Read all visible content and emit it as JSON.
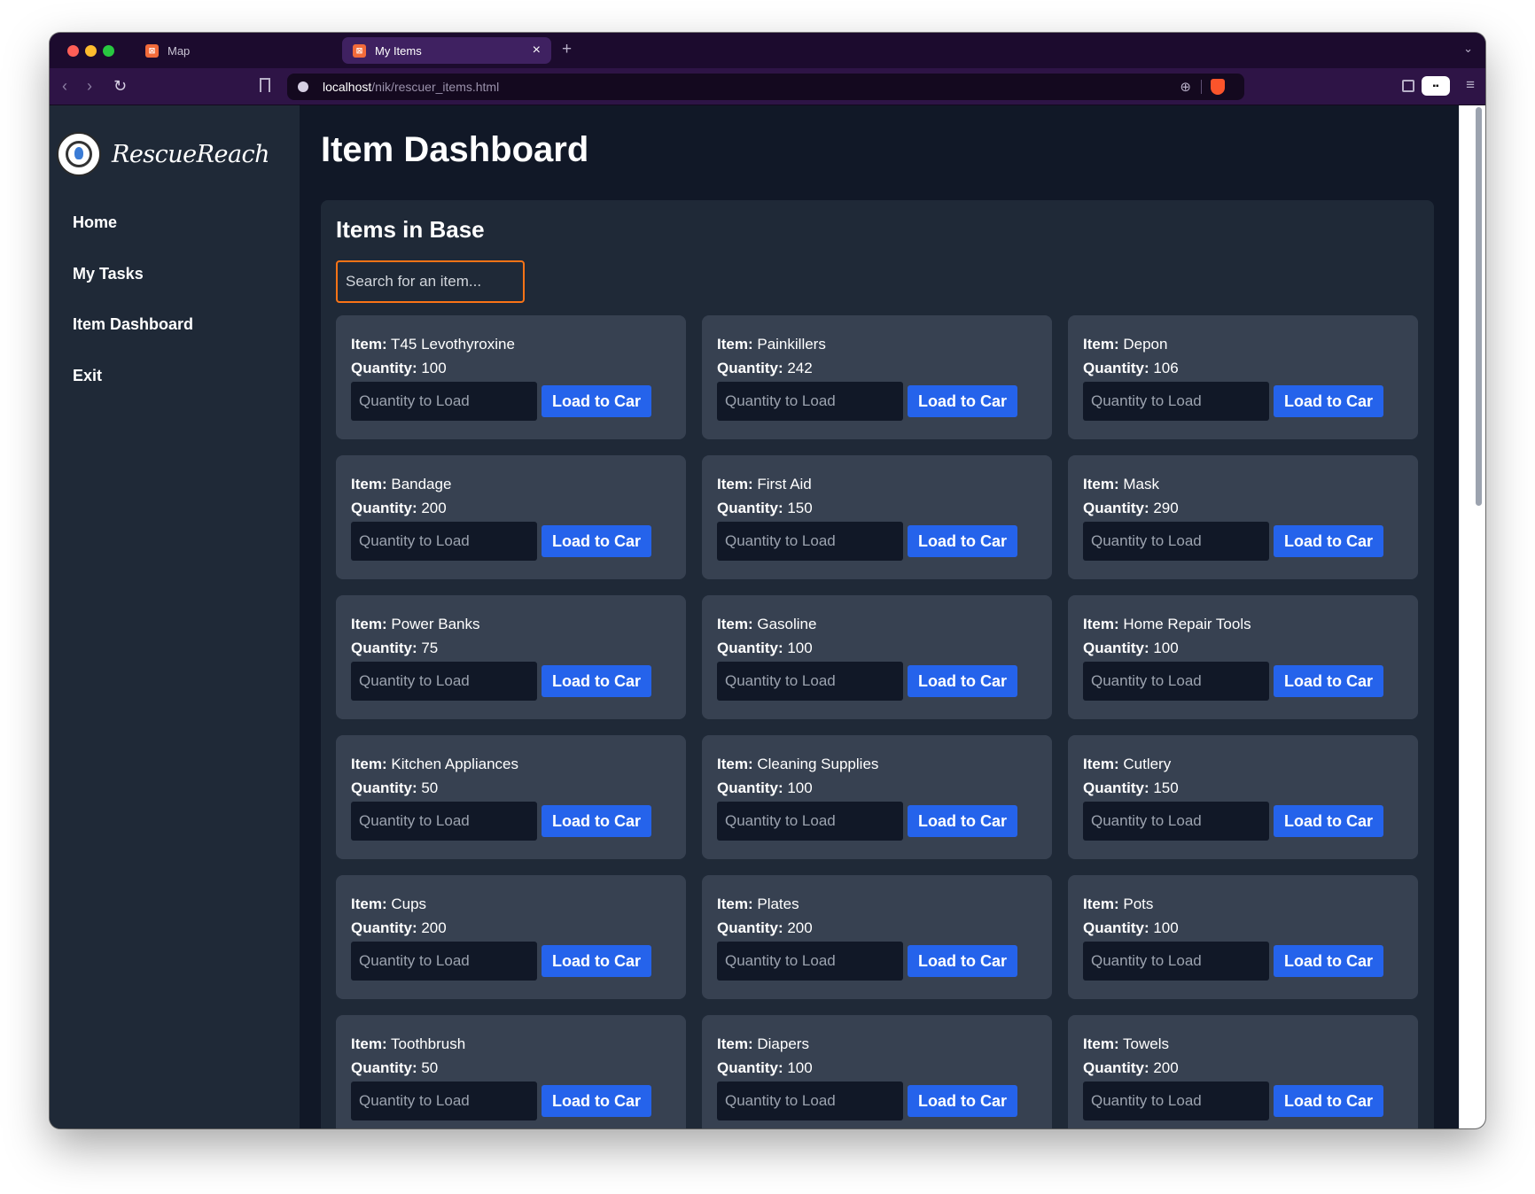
{
  "browser": {
    "tabs": [
      {
        "label": "Map",
        "active": false
      },
      {
        "label": "My Items",
        "active": true
      }
    ],
    "url_host": "localhost",
    "url_path": "/nik/rescuer_items.html"
  },
  "brand": {
    "name": "RescueReach"
  },
  "nav": {
    "items": [
      {
        "label": "Home"
      },
      {
        "label": "My Tasks"
      },
      {
        "label": "Item Dashboard"
      },
      {
        "label": "Exit"
      }
    ]
  },
  "main": {
    "title": "Item Dashboard",
    "section_title": "Items in Base",
    "search_placeholder": "Search for an item...",
    "item_label": "Item:",
    "quantity_label": "Quantity:",
    "qty_placeholder": "Quantity to Load",
    "load_label": "Load to Car",
    "items": [
      {
        "name": "T45 Levothyroxine",
        "quantity": "100"
      },
      {
        "name": "Painkillers",
        "quantity": "242"
      },
      {
        "name": "Depon",
        "quantity": "106"
      },
      {
        "name": "Bandage",
        "quantity": "200"
      },
      {
        "name": "First Aid",
        "quantity": "150"
      },
      {
        "name": "Mask",
        "quantity": "290"
      },
      {
        "name": "Power Banks",
        "quantity": "75"
      },
      {
        "name": "Gasoline",
        "quantity": "100"
      },
      {
        "name": "Home Repair Tools",
        "quantity": "100"
      },
      {
        "name": "Kitchen Appliances",
        "quantity": "50"
      },
      {
        "name": "Cleaning Supplies",
        "quantity": "100"
      },
      {
        "name": "Cutlery",
        "quantity": "150"
      },
      {
        "name": "Cups",
        "quantity": "200"
      },
      {
        "name": "Plates",
        "quantity": "200"
      },
      {
        "name": "Pots",
        "quantity": "100"
      },
      {
        "name": "Toothbrush",
        "quantity": "50"
      },
      {
        "name": "Diapers",
        "quantity": "100"
      },
      {
        "name": "Towels",
        "quantity": "200"
      }
    ]
  },
  "colors": {
    "page_bg": "#111827",
    "sidebar_bg": "#1f2937",
    "card_bg": "#374151",
    "button": "#2563eb",
    "search_border": "#f97316"
  }
}
